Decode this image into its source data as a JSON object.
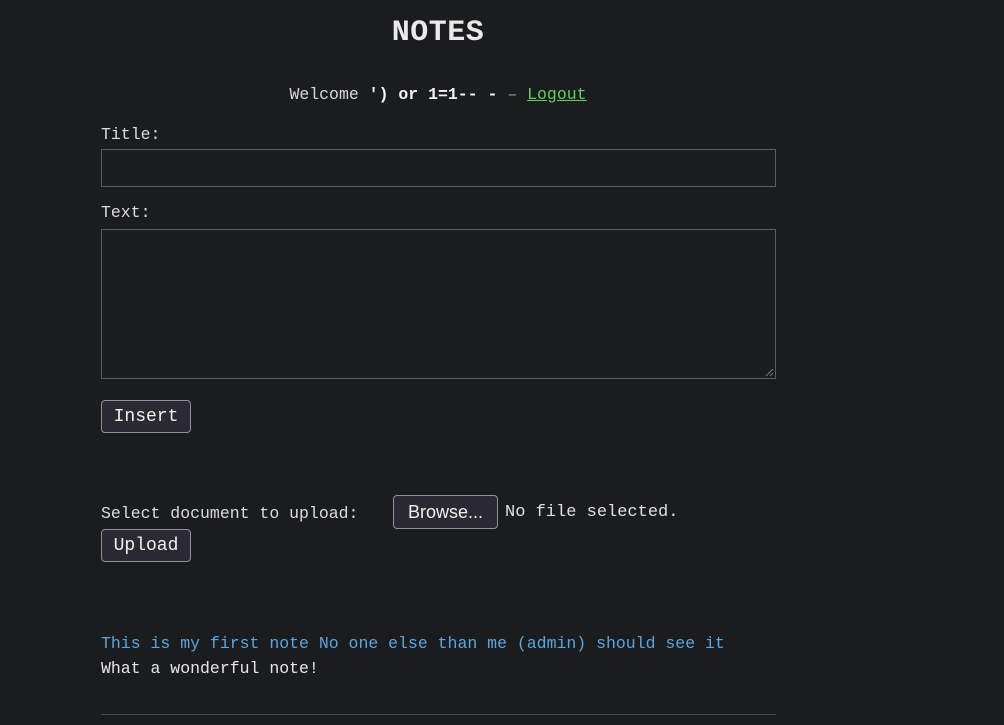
{
  "header": {
    "title": "NOTES"
  },
  "session": {
    "welcome_prefix": "Welcome",
    "username": "') or 1=1-- -",
    "separator": "–",
    "logout_label": "Logout"
  },
  "form": {
    "title_label": "Title:",
    "title_value": "",
    "text_label": "Text:",
    "text_value": "",
    "insert_label": "Insert"
  },
  "upload": {
    "select_label": "Select document to upload:",
    "browse_label": "Browse...",
    "file_status": "No file selected.",
    "upload_label": "Upload"
  },
  "notes": [
    {
      "title": "This is my first note No one else than me (admin) should see it",
      "text": "What a wonderful note!"
    }
  ],
  "colors": {
    "background": "#1b1c1e",
    "link": "#61d25e",
    "note_title": "#5aa6e0",
    "text": "#e6e6e6"
  }
}
